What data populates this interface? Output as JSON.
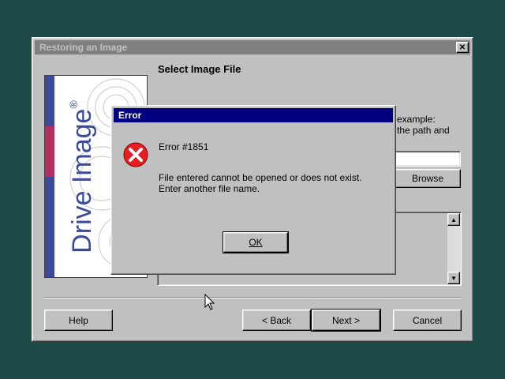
{
  "main_window": {
    "title": "Restoring an Image",
    "close_glyph": "✕",
    "heading": "Select Image File",
    "partial_text_line1": "example:",
    "partial_text_line2": "the path and",
    "browse_label": "Browse",
    "help_label": "Help",
    "back_label": "< Back",
    "next_label": "Next >",
    "cancel_label": "Cancel"
  },
  "sidebar_image": {
    "logo_text": "Drive Image",
    "registered_mark": "®"
  },
  "error_dialog": {
    "title": "Error",
    "error_code": "Error #1851",
    "message_line1": "File entered cannot be opened or does not exist.",
    "message_line2": "Enter another file name.",
    "ok_label": "OK",
    "icon": "error-x-icon"
  },
  "colors": {
    "desktop": "#1d4a46",
    "active_title": "#000080",
    "inactive_title": "#808080",
    "error_icon": "#e81c23"
  }
}
